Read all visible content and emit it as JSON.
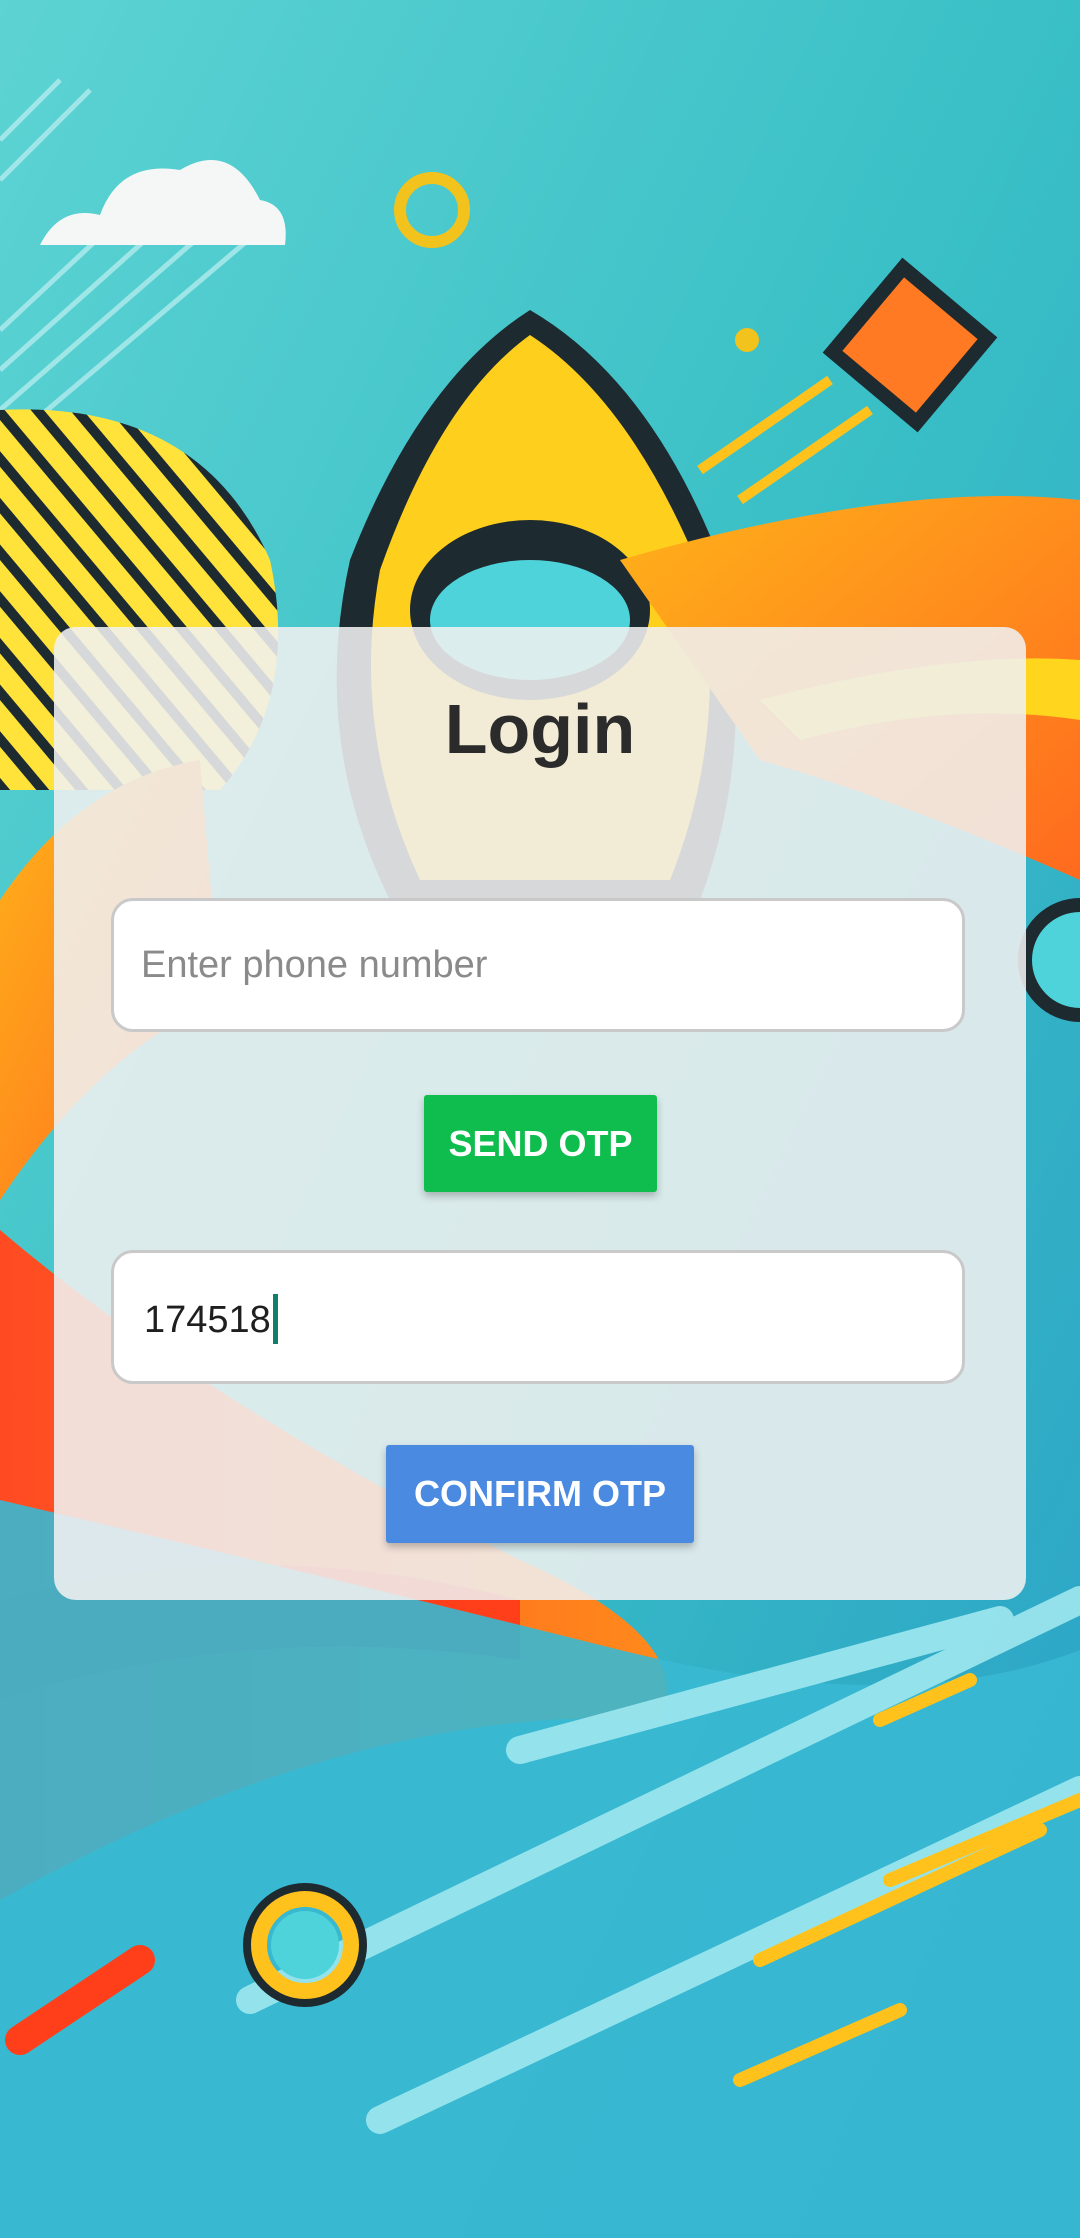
{
  "login": {
    "title": "Login",
    "phone_placeholder": "Enter phone number",
    "phone_value": "",
    "send_otp_label": "SEND OTP",
    "otp_value": "174518",
    "confirm_otp_label": "CONFIRM OTP"
  },
  "colors": {
    "send_button": "#0fbd4e",
    "confirm_button": "#4a8ae0",
    "caret": "#0f7f6c",
    "background": "#3fc4c8"
  }
}
